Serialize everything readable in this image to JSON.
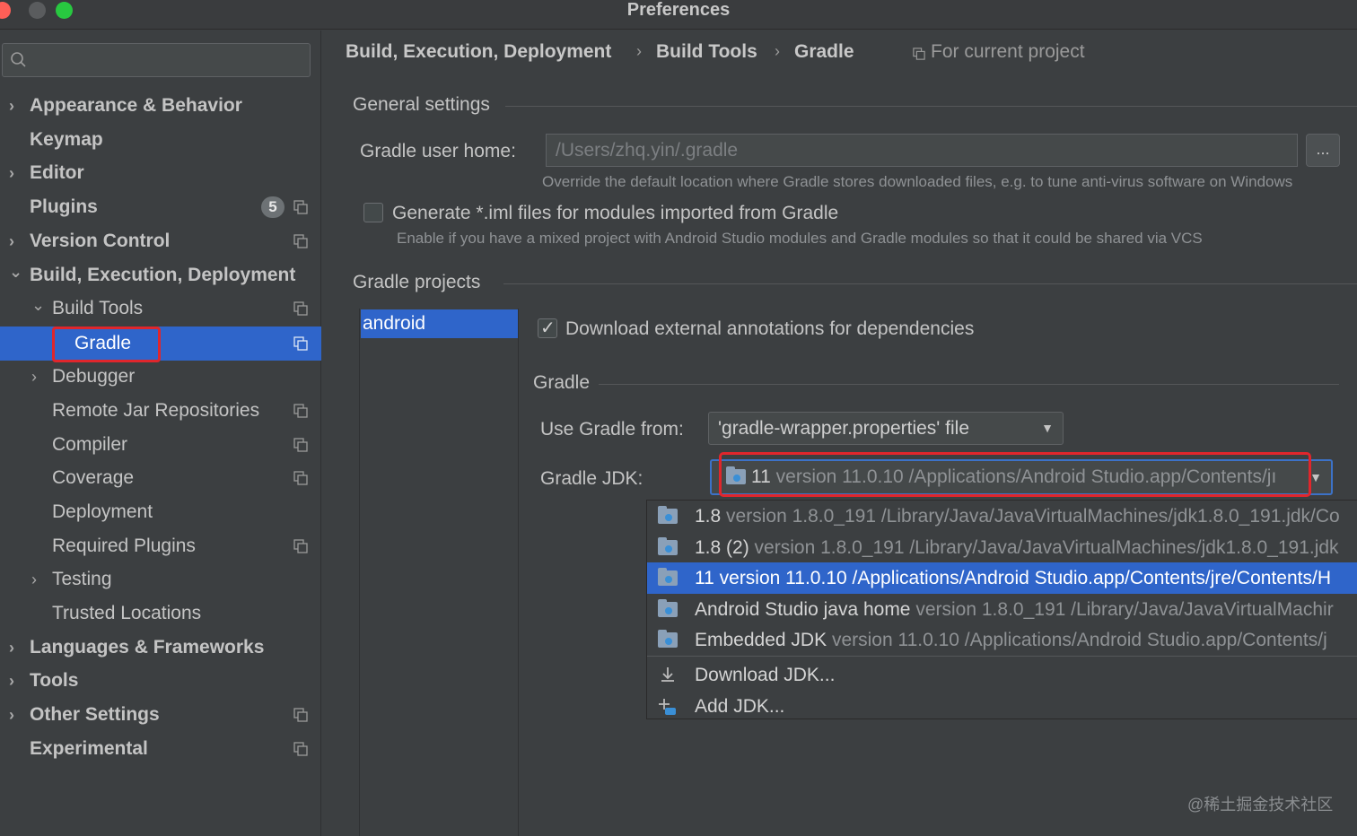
{
  "window": {
    "title": "Preferences"
  },
  "sidebar": {
    "search_placeholder": "",
    "items": [
      {
        "label": "Appearance & Behavior",
        "chevron": "›"
      },
      {
        "label": "Keymap"
      },
      {
        "label": "Editor",
        "chevron": "›"
      },
      {
        "label": "Plugins",
        "badge": "5"
      },
      {
        "label": "Version Control",
        "chevron": "›"
      },
      {
        "label": "Build, Execution, Deployment",
        "chevron": "⌄"
      },
      {
        "label": "Build Tools",
        "chevron": "⌄"
      },
      {
        "label": "Gradle"
      },
      {
        "label": "Debugger",
        "chevron": "›"
      },
      {
        "label": "Remote Jar Repositories"
      },
      {
        "label": "Compiler"
      },
      {
        "label": "Coverage"
      },
      {
        "label": "Deployment"
      },
      {
        "label": "Required Plugins"
      },
      {
        "label": "Testing",
        "chevron": "›"
      },
      {
        "label": "Trusted Locations"
      },
      {
        "label": "Languages & Frameworks",
        "chevron": "›"
      },
      {
        "label": "Tools",
        "chevron": "›"
      },
      {
        "label": "Other Settings",
        "chevron": "›"
      },
      {
        "label": "Experimental"
      }
    ]
  },
  "breadcrumb": {
    "items": [
      "Build, Execution, Deployment",
      "Build Tools",
      "Gradle"
    ],
    "separator": "›",
    "scope": "For current project"
  },
  "general": {
    "title": "General settings",
    "user_home_label": "Gradle user home:",
    "user_home_value": "/Users/zhq.yin/.gradle",
    "browse_label": "...",
    "user_home_hint": "Override the default location where Gradle stores downloaded files, e.g. to tune anti-virus software on Windows",
    "iml_label": "Generate *.iml files for modules imported from Gradle",
    "iml_checked": false,
    "iml_hint": "Enable if you have a mixed project with Android Studio modules and Gradle modules so that it could be shared via VCS"
  },
  "projects": {
    "title": "Gradle projects",
    "list": [
      "android"
    ],
    "annotations_label": "Download external annotations for dependencies",
    "annotations_checked": true,
    "gradle_section": "Gradle",
    "use_from_label": "Use Gradle from:",
    "use_from_value": "'gradle-wrapper.properties' file",
    "jdk_label": "Gradle JDK:",
    "jdk_selected_name": "11",
    "jdk_selected_detail": "version 11.0.10 /Applications/Android Studio.app/Contents/jı"
  },
  "jdk_popup": {
    "items": [
      {
        "name": "1.8",
        "detail": "version 1.8.0_191 /Library/Java/JavaVirtualMachines/jdk1.8.0_191.jdk/Co",
        "icon": "folder-jdk-icon"
      },
      {
        "name": "1.8 (2)",
        "detail": "version 1.8.0_191 /Library/Java/JavaVirtualMachines/jdk1.8.0_191.jdk",
        "icon": "folder-jdk-icon"
      },
      {
        "name": "11 version 11.0.10 /Applications/Android Studio.app/Contents/jre/Contents/H",
        "detail": "",
        "icon": "folder-jdk-icon",
        "selected": true
      },
      {
        "name": "Android Studio java home",
        "detail": "version 1.8.0_191 /Library/Java/JavaVirtualMachir",
        "icon": "folder-jdk-icon"
      },
      {
        "name": "Embedded JDK",
        "detail": "version 11.0.10 /Applications/Android Studio.app/Contents/j",
        "icon": "folder-jdk-icon"
      }
    ],
    "actions": [
      {
        "label": "Download JDK...",
        "icon": "download-icon"
      },
      {
        "label": "Add JDK...",
        "icon": "add-jdk-icon"
      }
    ]
  },
  "watermark": "@稀土掘金技术社区",
  "colors": {
    "selection": "#2f65ca",
    "highlight_box": "#e0262c",
    "background": "#3c3f41"
  }
}
